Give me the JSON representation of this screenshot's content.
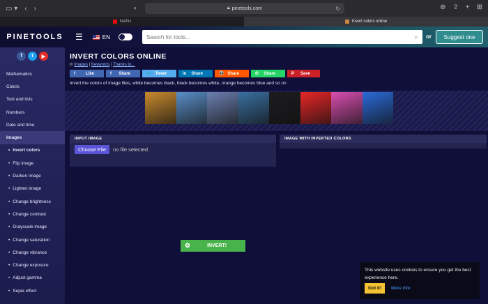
{
  "browser": {
    "url": "pinetools.com",
    "tabs": [
      {
        "label": "Netflix",
        "active": false,
        "color": "#e50914"
      },
      {
        "label": "Invert colors online",
        "active": true,
        "color": "#c84"
      }
    ]
  },
  "header": {
    "logo": "PINETOOLS",
    "lang": "EN",
    "search_placeholder": "Search for tools...",
    "or": "or",
    "suggest": "Suggest one"
  },
  "social_circles": [
    {
      "icon": "f",
      "color": "#3b5998"
    },
    {
      "icon": "t",
      "color": "#1da1f2"
    },
    {
      "icon": "▶",
      "color": "#e52d27"
    }
  ],
  "sidebar": {
    "categories": [
      "Mathematics",
      "Colors",
      "Text and lists",
      "Numbers",
      "Date and time"
    ],
    "active_category": "Images",
    "subitems": [
      "Invert colors",
      "Flip image",
      "Darken image",
      "Lighten image",
      "Change brightness",
      "Change contrast",
      "Grayscale image",
      "Change saturation",
      "Change vibrance",
      "Change exposure",
      "Adjust gamma",
      "Sepia effect"
    ]
  },
  "page": {
    "title": "INVERT COLORS ONLINE",
    "crumb_in": "in",
    "crumb_images": "Images",
    "crumb_sep": "|",
    "crumb_keywords": "Keywords",
    "crumb_thanks": "Thanks to...",
    "description": "Invert the colors of image files, white becomes black, black becomes white, orange becomes blue and so on"
  },
  "share_buttons": [
    {
      "icon": "f",
      "label": "Like",
      "color": "#4267b2"
    },
    {
      "icon": "f",
      "label": "Share",
      "color": "#4267b2"
    },
    {
      "icon": "🐦",
      "label": "Tweet",
      "color": "#55acee"
    },
    {
      "icon": "in",
      "label": "Share",
      "color": "#0077b5"
    },
    {
      "icon": "👽",
      "label": "Share",
      "color": "#ff5700"
    },
    {
      "icon": "✆",
      "label": "Share",
      "color": "#25d366"
    },
    {
      "icon": "P",
      "label": "Save",
      "color": "#cb2027"
    }
  ],
  "banner_colors": [
    "#c98a2e",
    "#5a8fc8",
    "#6b7fb0",
    "#3a6fa0",
    "#1c1c20",
    "#e82626",
    "#d94fb0",
    "#2a6ad8"
  ],
  "panels": {
    "input_title": "INPUT IMAGE",
    "output_title": "IMAGE WITH INVERTED COLORS",
    "choose_file": "Choose File",
    "no_file": "no file selected"
  },
  "invert_button": "INVERT!",
  "cookie": {
    "text": "This website uses cookies to ensure you get the best experience here.",
    "got_it": "Got it!",
    "more_info": "More info"
  }
}
